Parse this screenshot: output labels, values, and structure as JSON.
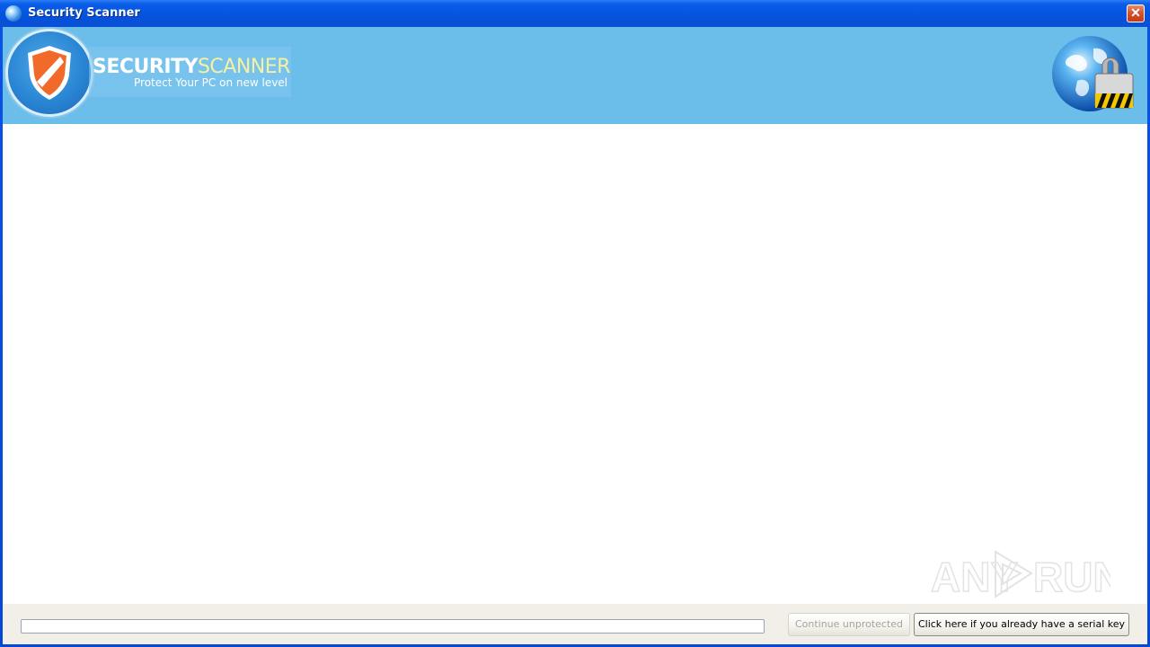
{
  "window": {
    "title": "Security Scanner",
    "close_glyph": "✕"
  },
  "banner": {
    "brand_primary": "SECURITY",
    "brand_secondary": "SCANNER",
    "tagline": "Protect Your PC on new level",
    "logo_icon": "shield-icon",
    "right_icon": "globe-lock-icon",
    "background_color": "#6bbdea"
  },
  "footer": {
    "progress_value": 0,
    "continue_label": "Continue unprotected",
    "serial_label": "Click here if you already have a serial key"
  },
  "watermark": {
    "left": "ANY",
    "right": "RUN"
  }
}
